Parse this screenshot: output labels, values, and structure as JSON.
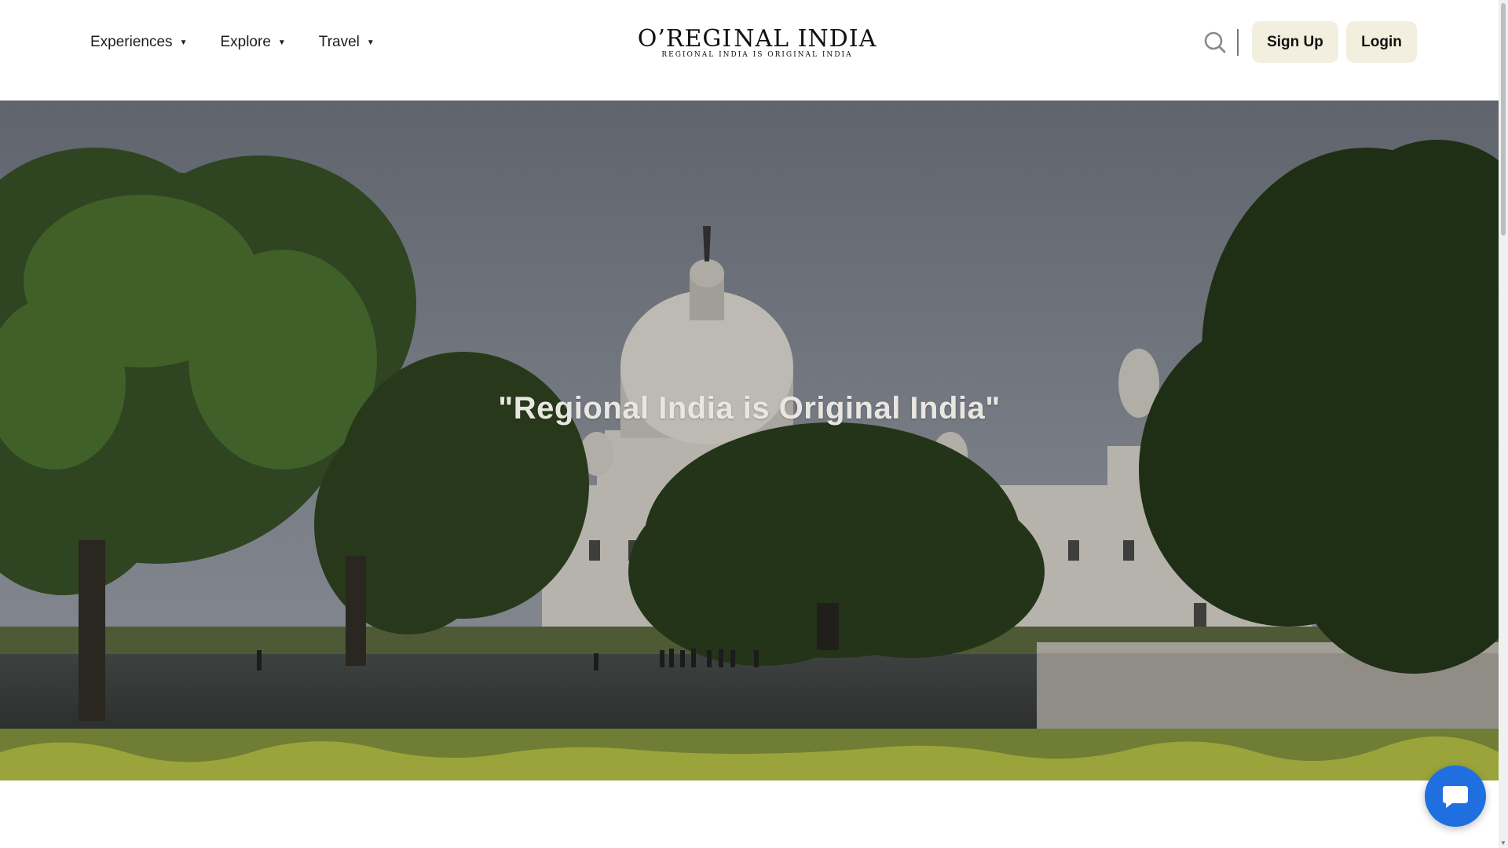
{
  "nav": {
    "items": [
      {
        "label": "Experiences"
      },
      {
        "label": "Explore"
      },
      {
        "label": "Travel"
      }
    ]
  },
  "logo": {
    "brand_left": "O’REGI",
    "brand_right": "NAL INDIA",
    "tagline": "REGIONAL INDIA IS ORIGINAL INDIA"
  },
  "actions": {
    "signup_label": "Sign Up",
    "login_label": "Login"
  },
  "hero": {
    "quote": "\"Regional India is Original India\""
  },
  "colors": {
    "button_bg": "#f3efdf",
    "chat_blue": "#1f6fe0",
    "sky": "#70757f"
  }
}
